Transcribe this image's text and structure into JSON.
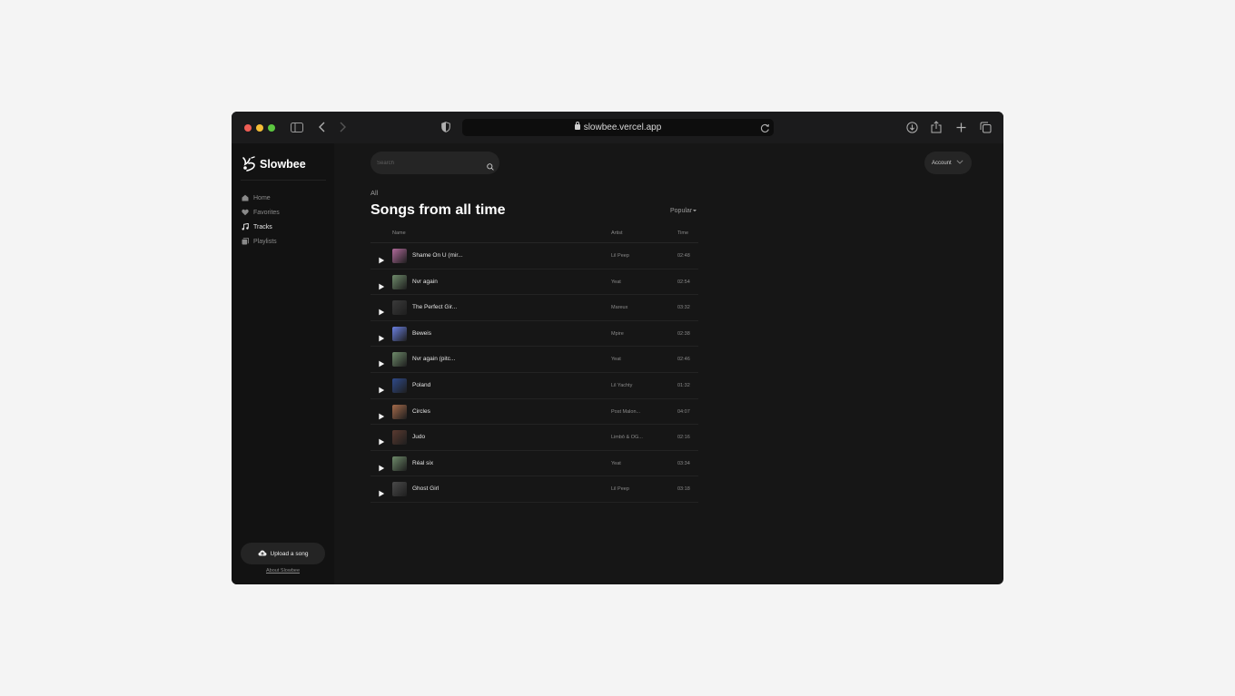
{
  "browser": {
    "url": "slowbee.vercel.app"
  },
  "sidebar": {
    "logo": "Slowbee",
    "items": [
      {
        "label": "Home",
        "icon": "home-icon"
      },
      {
        "label": "Favorites",
        "icon": "heart-icon"
      },
      {
        "label": "Tracks",
        "icon": "music-note-icon",
        "active": true
      },
      {
        "label": "Playlists",
        "icon": "playlist-icon"
      }
    ],
    "upload_label": "Upload a song",
    "about_label": "About Slowbee"
  },
  "header": {
    "search_placeholder": "Search",
    "account_label": "Account"
  },
  "main": {
    "breadcrumb": "All",
    "title": "Songs from all time",
    "sort_label": "Popular",
    "columns": {
      "name": "Name",
      "artist": "Artist",
      "time": "Time"
    },
    "tracks": [
      {
        "name": "Shame On U (mir...",
        "artist": "Lil Peep",
        "time": "02:48",
        "art": "#b06a9a"
      },
      {
        "name": "Nvr again",
        "artist": "Yeat",
        "time": "02:54",
        "art": "#6e8a6a"
      },
      {
        "name": "The Perfect Gir...",
        "artist": "Mareux",
        "time": "03:32",
        "art": "#3a3a3a"
      },
      {
        "name": "Beweis",
        "artist": "Mpire",
        "time": "02:38",
        "art": "#6a7fe0"
      },
      {
        "name": "Nvr again (pitc...",
        "artist": "Yeat",
        "time": "02:46",
        "art": "#6e8a6a"
      },
      {
        "name": "Poland",
        "artist": "Lil Yachty",
        "time": "01:32",
        "art": "#2f4a8a"
      },
      {
        "name": "Circles",
        "artist": "Post Malon...",
        "time": "04:07",
        "art": "#a46a4a"
      },
      {
        "name": "Judo",
        "artist": "Limbô & OG...",
        "time": "02:16",
        "art": "#5a3a30"
      },
      {
        "name": "Réal six",
        "artist": "Yeat",
        "time": "03:34",
        "art": "#6e8a6a"
      },
      {
        "name": "Ghost Girl",
        "artist": "Lil Peep",
        "time": "03:18",
        "art": "#4a4a4a"
      }
    ]
  }
}
